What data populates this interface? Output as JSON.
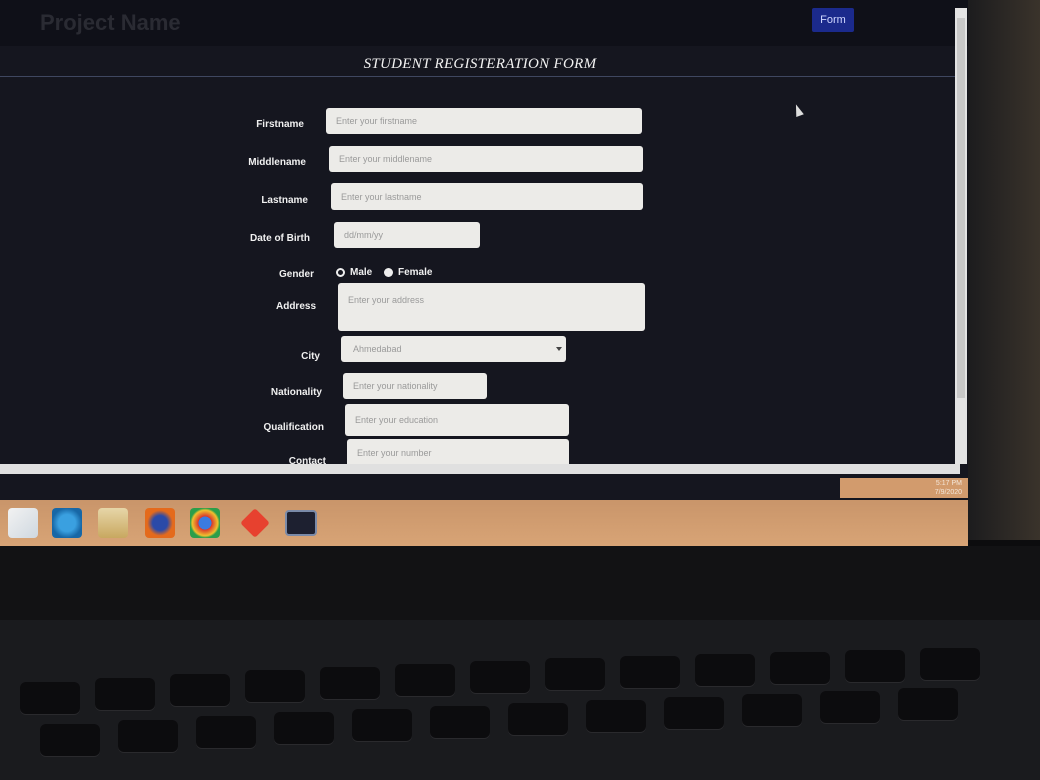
{
  "app": {
    "brand": "Project Name",
    "nav_form": "Form"
  },
  "form": {
    "title": "STUDENT REGISTERATION FORM",
    "firstname": {
      "label": "Firstname",
      "placeholder": "Enter your firstname"
    },
    "middlename": {
      "label": "Middlename",
      "placeholder": "Enter your middlename"
    },
    "lastname": {
      "label": "Lastname",
      "placeholder": "Enter your lastname"
    },
    "dob": {
      "label": "Date of Birth",
      "placeholder": "dd/mm/yy"
    },
    "gender": {
      "label": "Gender",
      "option_male": "Male",
      "option_female": "Female",
      "selected": "Female"
    },
    "address": {
      "label": "Address",
      "placeholder": "Enter your address"
    },
    "city": {
      "label": "City",
      "value": "Ahmedabad"
    },
    "nationality": {
      "label": "Nationality",
      "placeholder": "Enter your nationality"
    },
    "qualification": {
      "label": "Qualification",
      "placeholder": "Enter your education"
    },
    "contact": {
      "label": "Contact",
      "placeholder": "Enter your number"
    }
  },
  "taskbar": {
    "icons": [
      "windows-start-icon",
      "internet-explorer-icon",
      "file-explorer-icon",
      "firefox-icon",
      "chrome-icon",
      "git-icon",
      "command-prompt-icon"
    ],
    "time": "5:17 PM",
    "date": "7/9/2020"
  }
}
